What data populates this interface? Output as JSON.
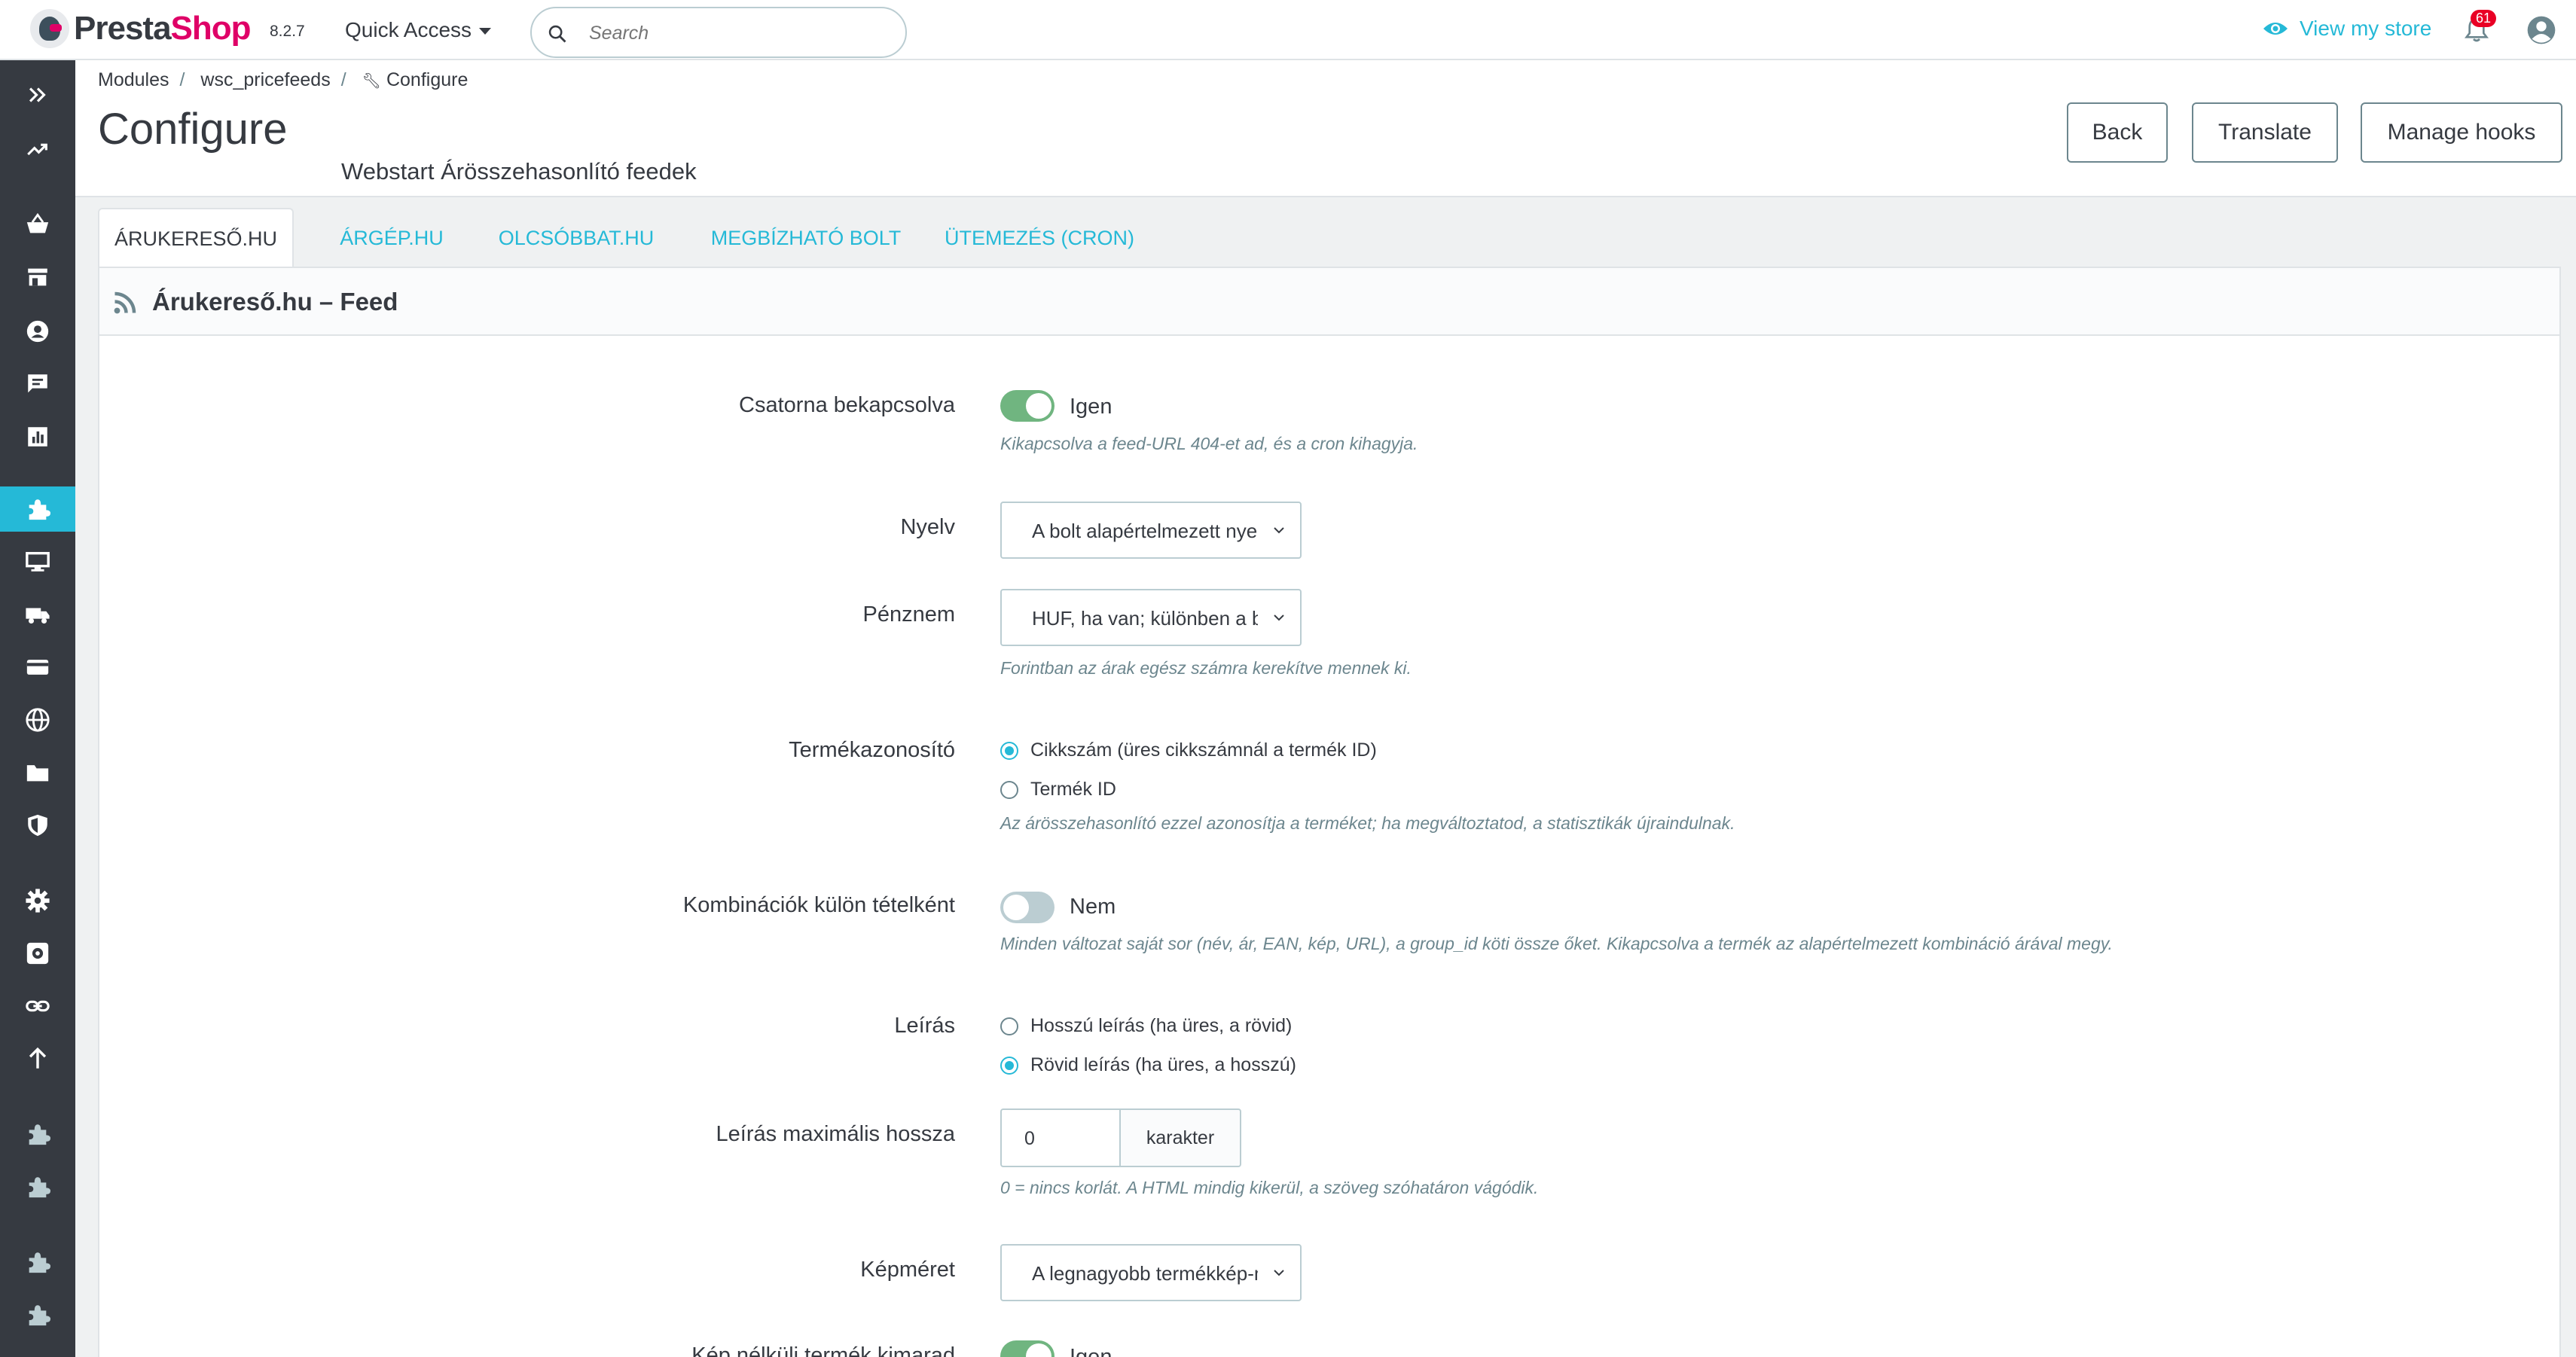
{
  "header": {
    "logo_text_pre": "Presta",
    "logo_text_post": "Shop",
    "version": "8.2.7",
    "quick_access": "Quick Access",
    "search_placeholder": "Search",
    "view_store": "View my store",
    "notifications_count": "61",
    "accent_color": "#25b9d7",
    "brand_color": "#df0067"
  },
  "sidebar": {
    "items": [
      {
        "icon": "expand-icon"
      },
      {
        "icon": "trending-icon"
      },
      {
        "icon": "basket-icon"
      },
      {
        "icon": "store-icon"
      },
      {
        "icon": "customer-icon"
      },
      {
        "icon": "chat-icon"
      },
      {
        "icon": "stats-icon"
      },
      {
        "icon": "modules-icon",
        "active": true
      },
      {
        "icon": "design-icon"
      },
      {
        "icon": "shipping-icon"
      },
      {
        "icon": "payment-icon"
      },
      {
        "icon": "international-icon"
      },
      {
        "icon": "folder-icon"
      },
      {
        "icon": "shield-icon"
      },
      {
        "icon": "gear-icon"
      },
      {
        "icon": "advanced-icon"
      },
      {
        "icon": "link-icon"
      },
      {
        "icon": "upgrade-icon"
      },
      {
        "icon": "puzzle-icon"
      },
      {
        "icon": "puzzle-icon"
      },
      {
        "icon": "puzzle-icon"
      },
      {
        "icon": "puzzle-icon"
      }
    ]
  },
  "breadcrumb": {
    "items": [
      "Modules",
      "wsc_pricefeeds",
      "Configure"
    ]
  },
  "page": {
    "title": "Configure",
    "module_name": "Webstart Árösszehasonlító feedek",
    "buttons": {
      "back": "Back",
      "translate": "Translate",
      "manage_hooks": "Manage hooks"
    }
  },
  "tabs": [
    {
      "label": "ÁRUKERESŐ.HU",
      "active": true
    },
    {
      "label": "ÁRGÉP.HU"
    },
    {
      "label": "OLCSÓBBAT.HU"
    },
    {
      "label": "MEGBÍZHATÓ BOLT"
    },
    {
      "label": "ÜTEMEZÉS (CRON)"
    }
  ],
  "panel": {
    "title": "Árukereső.hu – Feed",
    "fields": {
      "channel": {
        "label": "Csatorna bekapcsolva",
        "state": "on",
        "value_text": "Igen",
        "help": "Kikapcsolva a feed-URL 404-et ad, és a cron kihagyja."
      },
      "language": {
        "label": "Nyelv",
        "value": "A bolt alapértelmezett nyelve"
      },
      "currency": {
        "label": "Pénznem",
        "value": "HUF, ha van; különben a bolt alapértelmezett pénzneme",
        "help": "Forintban az árak egész számra kerekítve mennek ki."
      },
      "product_id": {
        "label": "Termékazonosító",
        "options": [
          "Cikkszám (üres cikkszámnál a termék ID)",
          "Termék ID"
        ],
        "selected": 0,
        "help": "Az árösszehasonlító ezzel azonosítja a terméket; ha megváltoztatod, a statisztikák újraindulnak."
      },
      "combinations": {
        "label": "Kombinációk külön tételként",
        "state": "off",
        "value_text": "Nem",
        "help": "Minden változat saját sor (név, ár, EAN, kép, URL), a group_id köti össze őket. Kikapcsolva a termék az alapértelmezett kombináció árával megy."
      },
      "description": {
        "label": "Leírás",
        "options": [
          "Hosszú leírás (ha üres, a rövid)",
          "Rövid leírás (ha üres, a hosszú)"
        ],
        "selected": 1
      },
      "desc_max_length": {
        "label": "Leírás maximális hossza",
        "value": "0",
        "addon": "karakter",
        "help": "0 = nincs korlát. A HTML mindig kikerül, a szöveg szóhatáron vágódik."
      },
      "image_size": {
        "label": "Képméret",
        "value": "A legnagyobb termékkép-méret"
      },
      "no_image": {
        "label": "Kép nélküli termék kimarad",
        "state": "on",
        "value_text": "Igen"
      }
    }
  }
}
